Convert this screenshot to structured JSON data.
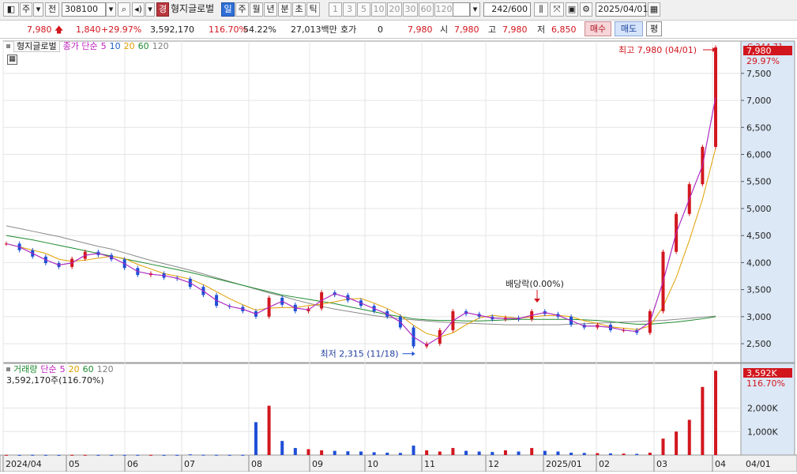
{
  "toolbar": {
    "market": "주",
    "prev_label": "전",
    "code": "308100",
    "badge": "경",
    "name": "형지글로벌",
    "periods": [
      "일",
      "주",
      "월",
      "년",
      "분",
      "초",
      "틱"
    ],
    "selected_period": "일",
    "intervals": [
      "1",
      "3",
      "5",
      "10",
      "20",
      "30",
      "60",
      "120"
    ],
    "count_shown": "242",
    "count_total": "/600",
    "date": "2025/04/01"
  },
  "quote": {
    "price": "7,980",
    "change": "1,840",
    "change_pct": "+29.97%",
    "volume": "3,592,170",
    "volume_ratio": "116.70%",
    "turnover": "54.22%",
    "amount": "27,013백만",
    "hoga_label": "호가",
    "hoga_value": "0",
    "hoga_price": "7,980",
    "open_label": "시",
    "open": "7,980",
    "high_label": "고",
    "high": "7,980",
    "low_label": "저",
    "low": "6,850",
    "buy_label": "매수",
    "sell_label": "매도",
    "eval_label": "평"
  },
  "price_legend": {
    "name": "형지글로벌",
    "label": "종가 단순",
    "ma": [
      {
        "period": "5",
        "color": "#c020c0"
      },
      {
        "period": "10",
        "color": "#1f5fc0"
      },
      {
        "period": "20",
        "color": "#e0a000"
      },
      {
        "period": "60",
        "color": "#1e8a2e"
      },
      {
        "period": "120",
        "color": "#808080"
      }
    ]
  },
  "volume_legend": {
    "label": "거래량",
    "ma_label": "단순",
    "ma": [
      {
        "period": "5",
        "color": "#c020c0"
      },
      {
        "period": "20",
        "color": "#e0a000"
      },
      {
        "period": "60",
        "color": "#1e8a2e"
      },
      {
        "period": "120",
        "color": "#808080"
      }
    ],
    "value": "3,592,170주(116.70%)"
  },
  "price_axis": {
    "ticks": [
      "7,500",
      "7,000",
      "6,500",
      "6,000",
      "5,500",
      "5,000",
      "4,500",
      "4,000",
      "3,500",
      "3,000",
      "2,500"
    ],
    "current_price": "7,980",
    "current_pct": "29.97%",
    "c_value": "C:244.71"
  },
  "volume_axis": {
    "ticks": [
      "2,000K",
      "1,000K"
    ],
    "current": "3,592K",
    "pct": "116.70%"
  },
  "annotations": {
    "high": "최고 7,980 (04/01)",
    "low": "최저 2,315 (11/18)",
    "dividend": "배당락(0.00%)"
  },
  "x_axis": {
    "labels": [
      "2024/04",
      "05",
      "06",
      "07",
      "08",
      "09",
      "10",
      "11",
      "12",
      "2025/01",
      "02",
      "03",
      "04"
    ],
    "right_label": "04/01"
  },
  "colors": {
    "up": "#d2161e",
    "down": "#1f4fd6",
    "axis_bg": "#dce8f6",
    "grid": "#e4e4e4"
  },
  "chart_data": {
    "type": "candlestick",
    "ylim": [
      2150,
      7980
    ],
    "x": [
      "2024/04",
      "05",
      "06",
      "07",
      "08",
      "09",
      "10",
      "11",
      "12",
      "2025/01",
      "02",
      "03",
      "04"
    ],
    "close": [
      4350,
      4230,
      4110,
      3990,
      3920,
      4070,
      4200,
      4140,
      4060,
      3900,
      3770,
      3800,
      3720,
      3700,
      3550,
      3400,
      3200,
      3180,
      3100,
      3000,
      3350,
      3220,
      3100,
      3150,
      3450,
      3400,
      3300,
      3200,
      3100,
      3000,
      2800,
      2450,
      2500,
      2750,
      3100,
      3050,
      3000,
      2950,
      2980,
      2950,
      3100,
      3050,
      3000,
      2850,
      2800,
      2850,
      2750,
      2750,
      2700,
      3100,
      4200,
      4900,
      5450,
      6140,
      7980
    ],
    "ma_120": [
      4680,
      4630,
      4580,
      4530,
      4480,
      4420,
      4360,
      4300,
      4250,
      4180,
      4110,
      4040,
      3980,
      3920,
      3860,
      3790,
      3720,
      3650,
      3580,
      3510,
      3440,
      3380,
      3310,
      3250,
      3190,
      3140,
      3100,
      3060,
      3020,
      2990,
      2960,
      2940,
      2920,
      2900,
      2890,
      2880,
      2870,
      2860,
      2850,
      2850,
      2850,
      2850,
      2850,
      2860,
      2870,
      2880,
      2890,
      2900,
      2910,
      2920,
      2930,
      2950,
      2970,
      2990,
      3010
    ],
    "ma_60": [
      4500,
      4460,
      4420,
      4370,
      4320,
      4270,
      4220,
      4170,
      4120,
      4070,
      4020,
      3970,
      3920,
      3870,
      3820,
      3760,
      3700,
      3640,
      3580,
      3520,
      3460,
      3400,
      3360,
      3320,
      3280,
      3240,
      3190,
      3140,
      3090,
      3040,
      3000,
      2960,
      2940,
      2930,
      2930,
      2920,
      2920,
      2930,
      2940,
      2950,
      2950,
      2950,
      2950,
      2950,
      2940,
      2930,
      2910,
      2880,
      2860,
      2860,
      2880,
      2900,
      2930,
      2960,
      3000
    ],
    "volume_k": [
      5,
      4,
      6,
      5,
      4,
      5,
      6,
      5,
      4,
      8,
      6,
      5,
      4,
      5,
      30,
      10,
      8,
      6,
      5,
      1400,
      2100,
      600,
      300,
      250,
      200,
      180,
      160,
      150,
      120,
      100,
      90,
      400,
      200,
      150,
      300,
      180,
      150,
      130,
      200,
      150,
      300,
      180,
      150,
      100,
      90,
      80,
      70,
      60,
      50,
      100,
      700,
      1000,
      1500,
      2900,
      3592
    ],
    "volume_ylim": [
      0,
      3700
    ],
    "volume_ticks": [
      1000,
      2000
    ]
  }
}
